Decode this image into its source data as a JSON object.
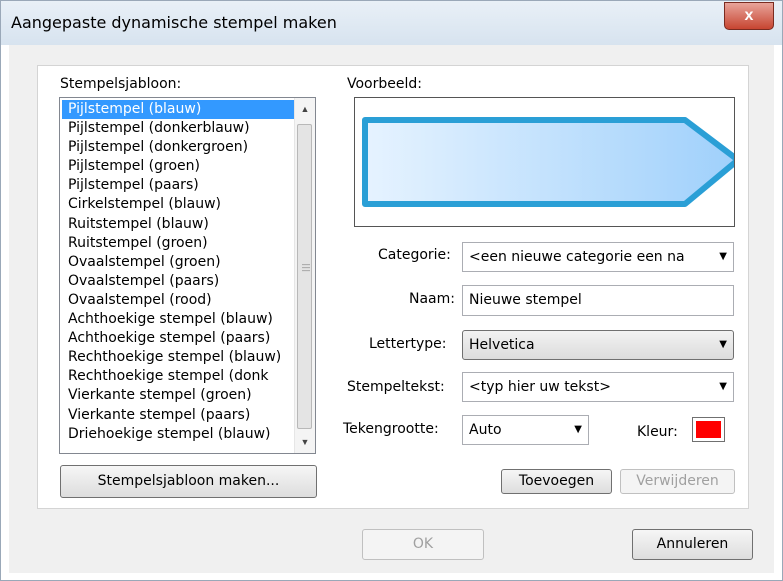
{
  "window": {
    "title": "Aangepaste dynamische stempel maken",
    "close_label": "x"
  },
  "templates": {
    "label": "Stempelsjabloon:",
    "items": [
      "Pijlstempel (blauw)",
      "Pijlstempel (donkerblauw)",
      "Pijlstempel (donkergroen)",
      "Pijlstempel (groen)",
      "Pijlstempel (paars)",
      "Cirkelstempel (blauw)",
      "Ruitstempel (blauw)",
      "Ruitstempel (groen)",
      "Ovaalstempel (groen)",
      "Ovaalstempel (paars)",
      "Ovaalstempel (rood)",
      "Achthoekige stempel (blauw)",
      "Achthoekige stempel (paars)",
      "Rechthoekige stempel (blauw)",
      "Rechthoekige stempel (donk",
      "Vierkante stempel (groen)",
      "Vierkante stempel (paars)",
      "Driehoekige stempel (blauw)"
    ],
    "selected_index": 0,
    "make_button": "Stempelsjabloon maken..."
  },
  "preview": {
    "label": "Voorbeeld:"
  },
  "form": {
    "category_label": "Categorie:",
    "category_value": "<een nieuwe categorie een na",
    "name_label": "Naam:",
    "name_value": "Nieuwe stempel",
    "font_label": "Lettertype:",
    "font_value": "Helvetica",
    "text_label": "Stempeltekst:",
    "text_value": "<typ hier uw tekst>",
    "size_label": "Tekengrootte:",
    "size_value": "Auto",
    "color_label": "Kleur:",
    "color_value": "#ff0000",
    "add_button": "Toevoegen",
    "remove_button": "Verwijderen"
  },
  "footer": {
    "ok_button": "OK",
    "cancel_button": "Annuleren"
  },
  "colors": {
    "selection": "#3399ff",
    "stamp_fill": "#bcdcfc",
    "stamp_border": "#2a9fd6"
  }
}
